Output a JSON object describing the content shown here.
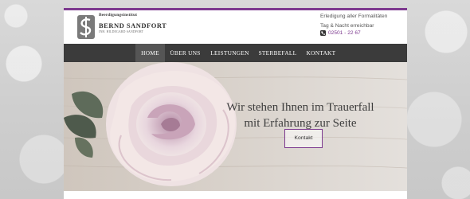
{
  "brand": {
    "top_label": "Beerdigungsinstitut",
    "name": "BERND SANDFORT",
    "sub_label": "INH. HILDEGARD SANDFORT",
    "logo_icon": "funeral-logo-icon"
  },
  "contact": {
    "line1": "Erledigung aller Formalitäten",
    "line2": "Tag & Nacht erreichbar",
    "phone": "02501 - 22 67",
    "phone_icon": "phone-icon"
  },
  "nav": {
    "items": [
      {
        "label": "HOME",
        "active": true
      },
      {
        "label": "ÜBER UNS",
        "active": false
      },
      {
        "label": "LEISTUNGEN",
        "active": false
      },
      {
        "label": "STERBEFALL",
        "active": false
      },
      {
        "label": "KONTAKT",
        "active": false
      }
    ]
  },
  "hero": {
    "title_line1": "Wir stehen Ihnen im Trauerfall",
    "title_line2": "mit Erfahrung zur Seite",
    "button_label": "Kontakt",
    "image": "rose-on-wood-image"
  },
  "colors": {
    "accent": "#7d3a8f",
    "nav_bg": "#3b3b3b",
    "nav_active": "#555555"
  }
}
